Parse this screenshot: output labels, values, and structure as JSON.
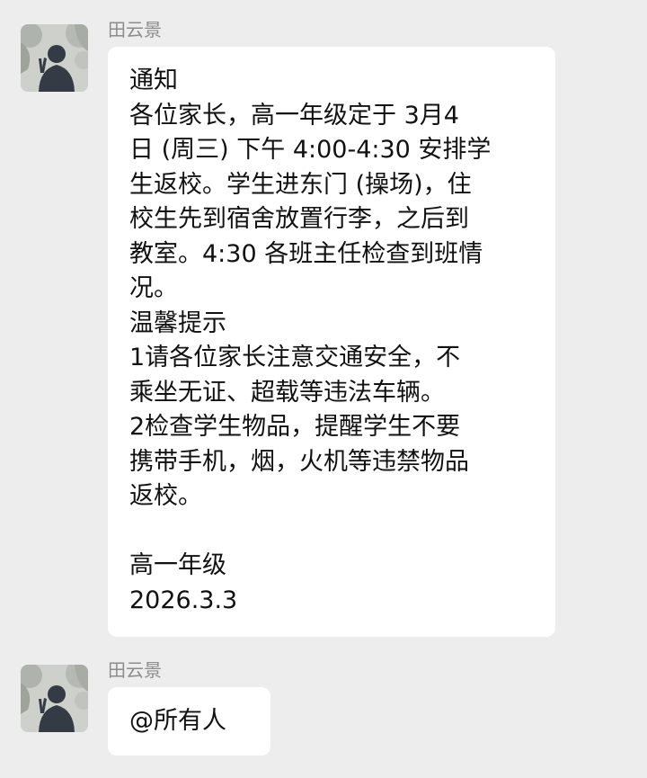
{
  "colors": {
    "background": "#ededed",
    "bubble": "#ffffff",
    "sender_name": "#8c8c8c",
    "message_text": "#111111"
  },
  "messages": [
    {
      "sender": "田云景",
      "avatar_icon": "avatar-silhouette-peace-sign",
      "lines": [
        "通知",
        "各位家长，高一年级定于 3月4",
        "日 (周三) 下午 4:00-4:30 安排学",
        "生返校。学生进东门 (操场)，住",
        "校生先到宿舍放置行李，之后到",
        "教室。4:30 各班主任检查到班情",
        "况。",
        "温馨提示",
        "1请各位家长注意交通安全，不",
        "乘坐无证、超载等违法车辆。",
        "2检查学生物品，提醒学生不要",
        "携带手机，烟，火机等违禁物品",
        "返校。",
        "",
        "高一年级",
        "2026.3.3"
      ]
    },
    {
      "sender": "田云景",
      "avatar_icon": "avatar-silhouette-peace-sign",
      "lines": [
        "@所有人"
      ]
    }
  ]
}
